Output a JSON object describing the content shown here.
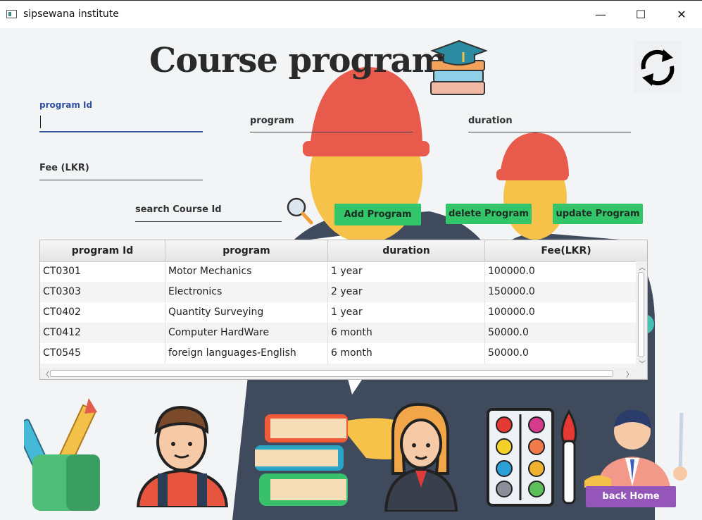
{
  "window": {
    "title": "sipsewana institute",
    "minimize": "—",
    "maximize": "☐",
    "close": "✕"
  },
  "page": {
    "heading": "Course program"
  },
  "form": {
    "program_id_label": "program Id",
    "program_label": "program",
    "duration_label": "duration",
    "fee_label": "Fee (LKR)",
    "search_label": "search Course Id"
  },
  "buttons": {
    "add": "Add Program",
    "delete": "delete Program",
    "update": "update Program",
    "back_home": "back Home"
  },
  "table": {
    "headers": [
      "program Id",
      "program",
      "duration",
      "Fee(LKR)"
    ],
    "rows": [
      [
        "CT0301",
        "Motor Mechanics",
        "1 year",
        "100000.0"
      ],
      [
        "CT0303",
        "Electronics",
        "2 year",
        "150000.0"
      ],
      [
        "CT0402",
        "Quantity Surveying",
        "1 year",
        "100000.0"
      ],
      [
        "CT0412",
        "Computer HardWare",
        "6 month",
        "50000.0"
      ],
      [
        "CT0545",
        "foreign languages-English",
        "6 month",
        "50000.0"
      ]
    ]
  },
  "colors": {
    "button_green": "#33c56a",
    "button_purple": "#9457b9",
    "focus_blue": "#3a5ba8"
  },
  "icons": [
    "graduation-cap-books-icon",
    "refresh-icon",
    "search-icon",
    "pencil-cup-icon",
    "student-boy-icon",
    "book-stack-icon",
    "student-girl-icon",
    "paint-palette-icon",
    "teacher-icon"
  ]
}
